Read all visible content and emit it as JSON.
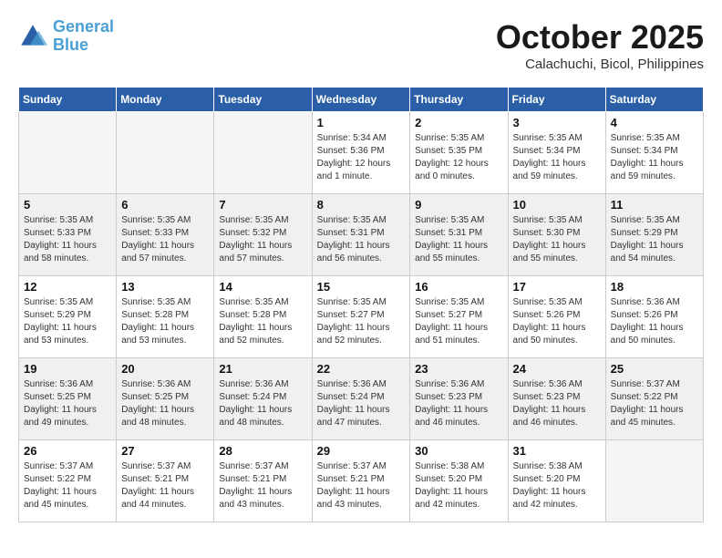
{
  "header": {
    "logo_line1": "General",
    "logo_line2": "Blue",
    "month": "October 2025",
    "location": "Calachuchi, Bicol, Philippines"
  },
  "days_of_week": [
    "Sunday",
    "Monday",
    "Tuesday",
    "Wednesday",
    "Thursday",
    "Friday",
    "Saturday"
  ],
  "weeks": [
    {
      "shaded": false,
      "days": [
        {
          "num": "",
          "info": ""
        },
        {
          "num": "",
          "info": ""
        },
        {
          "num": "",
          "info": ""
        },
        {
          "num": "1",
          "info": "Sunrise: 5:34 AM\nSunset: 5:36 PM\nDaylight: 12 hours\nand 1 minute."
        },
        {
          "num": "2",
          "info": "Sunrise: 5:35 AM\nSunset: 5:35 PM\nDaylight: 12 hours\nand 0 minutes."
        },
        {
          "num": "3",
          "info": "Sunrise: 5:35 AM\nSunset: 5:34 PM\nDaylight: 11 hours\nand 59 minutes."
        },
        {
          "num": "4",
          "info": "Sunrise: 5:35 AM\nSunset: 5:34 PM\nDaylight: 11 hours\nand 59 minutes."
        }
      ]
    },
    {
      "shaded": true,
      "days": [
        {
          "num": "5",
          "info": "Sunrise: 5:35 AM\nSunset: 5:33 PM\nDaylight: 11 hours\nand 58 minutes."
        },
        {
          "num": "6",
          "info": "Sunrise: 5:35 AM\nSunset: 5:33 PM\nDaylight: 11 hours\nand 57 minutes."
        },
        {
          "num": "7",
          "info": "Sunrise: 5:35 AM\nSunset: 5:32 PM\nDaylight: 11 hours\nand 57 minutes."
        },
        {
          "num": "8",
          "info": "Sunrise: 5:35 AM\nSunset: 5:31 PM\nDaylight: 11 hours\nand 56 minutes."
        },
        {
          "num": "9",
          "info": "Sunrise: 5:35 AM\nSunset: 5:31 PM\nDaylight: 11 hours\nand 55 minutes."
        },
        {
          "num": "10",
          "info": "Sunrise: 5:35 AM\nSunset: 5:30 PM\nDaylight: 11 hours\nand 55 minutes."
        },
        {
          "num": "11",
          "info": "Sunrise: 5:35 AM\nSunset: 5:29 PM\nDaylight: 11 hours\nand 54 minutes."
        }
      ]
    },
    {
      "shaded": false,
      "days": [
        {
          "num": "12",
          "info": "Sunrise: 5:35 AM\nSunset: 5:29 PM\nDaylight: 11 hours\nand 53 minutes."
        },
        {
          "num": "13",
          "info": "Sunrise: 5:35 AM\nSunset: 5:28 PM\nDaylight: 11 hours\nand 53 minutes."
        },
        {
          "num": "14",
          "info": "Sunrise: 5:35 AM\nSunset: 5:28 PM\nDaylight: 11 hours\nand 52 minutes."
        },
        {
          "num": "15",
          "info": "Sunrise: 5:35 AM\nSunset: 5:27 PM\nDaylight: 11 hours\nand 52 minutes."
        },
        {
          "num": "16",
          "info": "Sunrise: 5:35 AM\nSunset: 5:27 PM\nDaylight: 11 hours\nand 51 minutes."
        },
        {
          "num": "17",
          "info": "Sunrise: 5:35 AM\nSunset: 5:26 PM\nDaylight: 11 hours\nand 50 minutes."
        },
        {
          "num": "18",
          "info": "Sunrise: 5:36 AM\nSunset: 5:26 PM\nDaylight: 11 hours\nand 50 minutes."
        }
      ]
    },
    {
      "shaded": true,
      "days": [
        {
          "num": "19",
          "info": "Sunrise: 5:36 AM\nSunset: 5:25 PM\nDaylight: 11 hours\nand 49 minutes."
        },
        {
          "num": "20",
          "info": "Sunrise: 5:36 AM\nSunset: 5:25 PM\nDaylight: 11 hours\nand 48 minutes."
        },
        {
          "num": "21",
          "info": "Sunrise: 5:36 AM\nSunset: 5:24 PM\nDaylight: 11 hours\nand 48 minutes."
        },
        {
          "num": "22",
          "info": "Sunrise: 5:36 AM\nSunset: 5:24 PM\nDaylight: 11 hours\nand 47 minutes."
        },
        {
          "num": "23",
          "info": "Sunrise: 5:36 AM\nSunset: 5:23 PM\nDaylight: 11 hours\nand 46 minutes."
        },
        {
          "num": "24",
          "info": "Sunrise: 5:36 AM\nSunset: 5:23 PM\nDaylight: 11 hours\nand 46 minutes."
        },
        {
          "num": "25",
          "info": "Sunrise: 5:37 AM\nSunset: 5:22 PM\nDaylight: 11 hours\nand 45 minutes."
        }
      ]
    },
    {
      "shaded": false,
      "days": [
        {
          "num": "26",
          "info": "Sunrise: 5:37 AM\nSunset: 5:22 PM\nDaylight: 11 hours\nand 45 minutes."
        },
        {
          "num": "27",
          "info": "Sunrise: 5:37 AM\nSunset: 5:21 PM\nDaylight: 11 hours\nand 44 minutes."
        },
        {
          "num": "28",
          "info": "Sunrise: 5:37 AM\nSunset: 5:21 PM\nDaylight: 11 hours\nand 43 minutes."
        },
        {
          "num": "29",
          "info": "Sunrise: 5:37 AM\nSunset: 5:21 PM\nDaylight: 11 hours\nand 43 minutes."
        },
        {
          "num": "30",
          "info": "Sunrise: 5:38 AM\nSunset: 5:20 PM\nDaylight: 11 hours\nand 42 minutes."
        },
        {
          "num": "31",
          "info": "Sunrise: 5:38 AM\nSunset: 5:20 PM\nDaylight: 11 hours\nand 42 minutes."
        },
        {
          "num": "",
          "info": ""
        }
      ]
    }
  ]
}
